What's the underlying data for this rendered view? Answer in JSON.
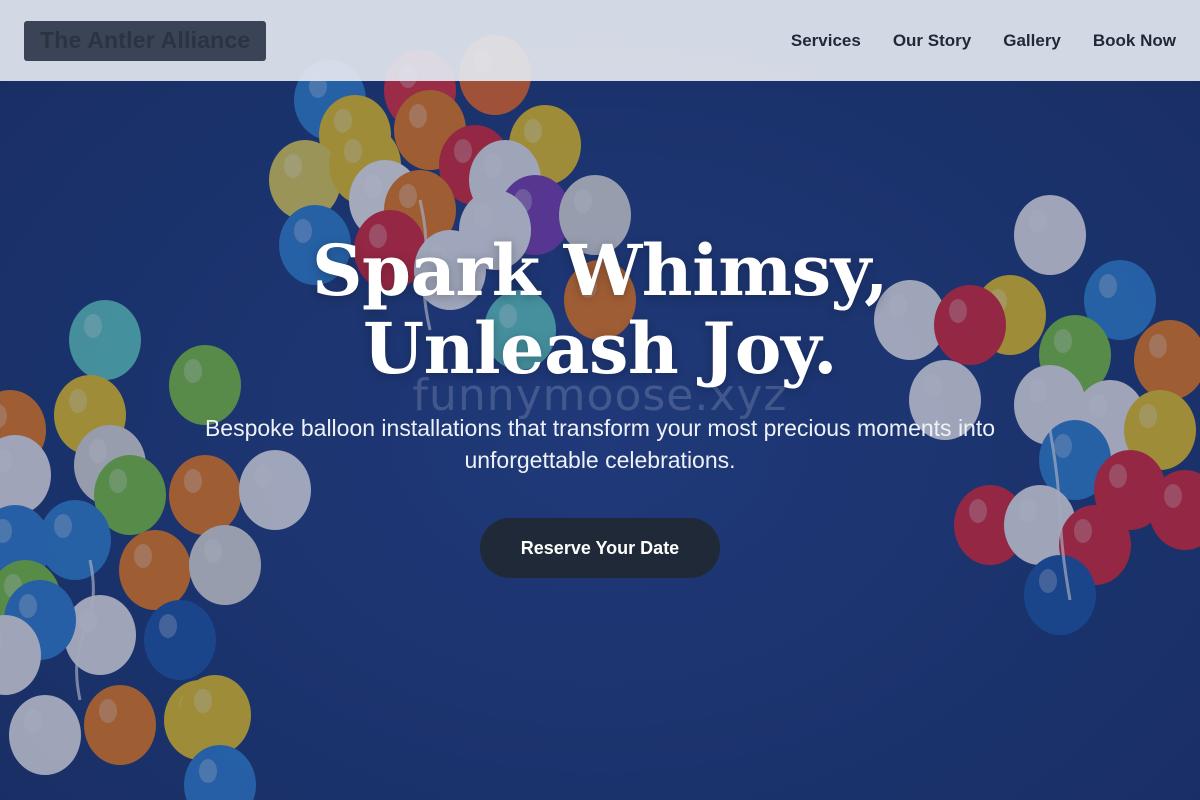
{
  "header": {
    "logo": "The Antler Alliance",
    "nav": [
      "Services",
      "Our Story",
      "Gallery",
      "Book Now"
    ]
  },
  "hero": {
    "headline": "Spark Whimsy, Unleash Joy.",
    "subheading": "Bespoke balloon installations that transform your most precious moments into unforgettable celebrations.",
    "cta_label": "Reserve Your Date",
    "watermark": "funnymoose.xyz"
  },
  "colors": {
    "sky": "#1e3a78",
    "header_bg": "#e2e6ee",
    "cta_bg": "#1f2937",
    "text_dark": "#1f2937"
  }
}
